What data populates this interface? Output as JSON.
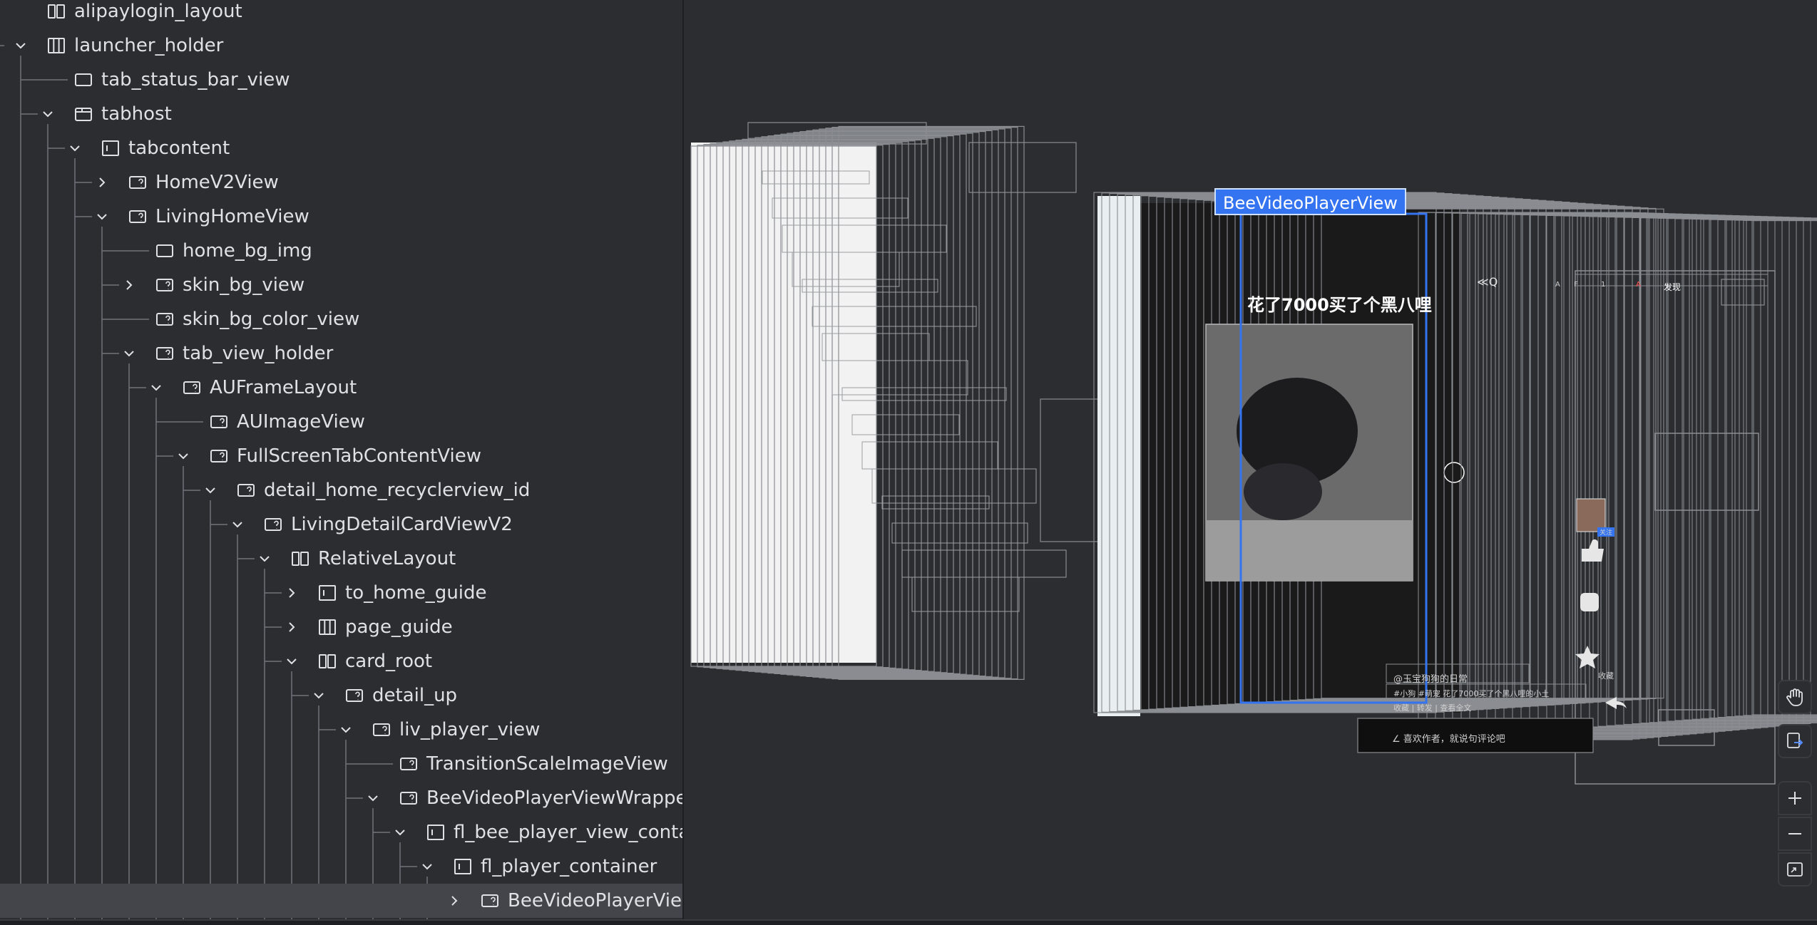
{
  "tree": {
    "items": [
      {
        "label": "alipaylogin_layout",
        "icon": "relative-layout-icon",
        "expand": "none",
        "depth": 0
      },
      {
        "label": "launcher_holder",
        "icon": "linear-layout-icon",
        "expand": "expanded",
        "depth": 0
      },
      {
        "label": "tab_status_bar_view",
        "icon": "view-icon",
        "expand": "none",
        "depth": 1
      },
      {
        "label": "tabhost",
        "icon": "tabhost-icon",
        "expand": "expanded",
        "depth": 1
      },
      {
        "label": "tabcontent",
        "icon": "frame-layout-icon",
        "expand": "expanded",
        "depth": 2
      },
      {
        "label": "HomeV2View",
        "icon": "custom-view-icon",
        "expand": "collapsed",
        "depth": 3
      },
      {
        "label": "LivingHomeView",
        "icon": "custom-view-icon",
        "expand": "expanded",
        "depth": 3
      },
      {
        "label": "home_bg_img",
        "icon": "view-icon",
        "expand": "none",
        "depth": 4
      },
      {
        "label": "skin_bg_view",
        "icon": "custom-view-icon",
        "expand": "collapsed",
        "depth": 4
      },
      {
        "label": "skin_bg_color_view",
        "icon": "custom-view-icon",
        "expand": "none",
        "depth": 4
      },
      {
        "label": "tab_view_holder",
        "icon": "custom-view-icon",
        "expand": "expanded",
        "depth": 4
      },
      {
        "label": "AUFrameLayout",
        "icon": "custom-view-icon",
        "expand": "expanded",
        "depth": 5
      },
      {
        "label": "AUImageView",
        "icon": "custom-view-icon",
        "expand": "none",
        "depth": 6
      },
      {
        "label": "FullScreenTabContentView",
        "icon": "custom-view-icon",
        "expand": "expanded",
        "depth": 6
      },
      {
        "label": "detail_home_recyclerview_id",
        "icon": "custom-view-icon",
        "expand": "expanded",
        "depth": 7
      },
      {
        "label": "LivingDetailCardViewV2",
        "icon": "custom-view-icon",
        "expand": "expanded",
        "depth": 8
      },
      {
        "label": "RelativeLayout",
        "icon": "relative-layout-icon",
        "expand": "expanded",
        "depth": 9
      },
      {
        "label": "to_home_guide",
        "icon": "frame-layout-icon",
        "expand": "collapsed",
        "depth": 10
      },
      {
        "label": "page_guide",
        "icon": "linear-layout-icon",
        "expand": "collapsed",
        "depth": 10
      },
      {
        "label": "card_root",
        "icon": "relative-layout-icon",
        "expand": "expanded",
        "depth": 10
      },
      {
        "label": "detail_up",
        "icon": "custom-view-icon",
        "expand": "expanded",
        "depth": 11
      },
      {
        "label": "liv_player_view",
        "icon": "custom-view-icon",
        "expand": "expanded",
        "depth": 12
      },
      {
        "label": "TransitionScaleImageView",
        "icon": "custom-view-icon",
        "expand": "none",
        "depth": 13
      },
      {
        "label": "BeeVideoPlayerViewWrapper",
        "icon": "custom-view-icon",
        "expand": "expanded",
        "depth": 13
      },
      {
        "label": "fl_bee_player_view_containe",
        "icon": "frame-layout-icon",
        "expand": "expanded",
        "depth": 14
      },
      {
        "label": "fl_player_container",
        "icon": "frame-layout-icon",
        "expand": "expanded",
        "depth": 15
      },
      {
        "label": "BeeVideoPlayerView",
        "icon": "custom-view-icon",
        "expand": "collapsed",
        "depth": 16,
        "selected": true
      }
    ]
  },
  "view3d": {
    "selected_label": "BeeVideoPlayerView",
    "video_title": "花了7000买了个黑八哩",
    "caption_lines": [
      "@玉宝狗狗的日常",
      "#小狗 #萌宠 花了7000买了个黑八哩的小土",
      "收藏 | 转发 | 查看全文"
    ],
    "comment_hint": "∠ 喜欢作者，就说句评论吧",
    "side_badge": "关注",
    "side_label": "收藏",
    "top_bar_items": [
      "≪Q",
      "A",
      "F",
      "1",
      "A",
      "发现"
    ]
  },
  "toolbar": {
    "buttons": [
      {
        "name": "pan-hand-icon"
      },
      {
        "name": "layer-export-icon"
      },
      {
        "name": "zoom-in-icon"
      },
      {
        "name": "zoom-out-icon"
      },
      {
        "name": "fit-screen-icon"
      }
    ]
  },
  "colors": {
    "selection": "#3574f0",
    "background": "#2b2d30",
    "text": "#dfe1e5",
    "guide_line": "#6f737a",
    "wireframe": "#8a8d92"
  }
}
